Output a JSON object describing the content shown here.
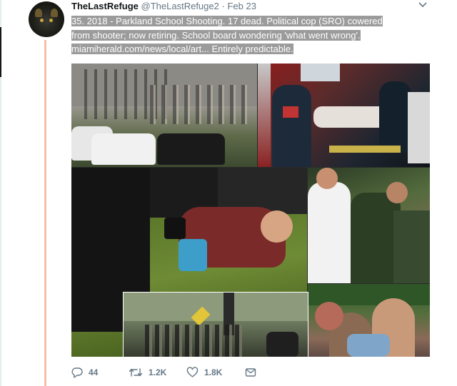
{
  "tweet": {
    "display_name": "TheLastRefuge",
    "handle": "@TheLastRefuge2",
    "separator": "·",
    "timestamp": "Feb 23",
    "text_line1": "35.  2018 -  Parkland School Shooting.  17 dead.  Political cop (SRO) cowered",
    "text_line2": "from shooter; now retiring.  School board wondering 'what went wrong'.",
    "text_line3": "miamiherald.com/news/local/art...  Entirely predictable."
  },
  "media": {
    "photo_count": 6
  },
  "actions": {
    "reply_count": "44",
    "retweet_count": "1.2K",
    "like_count": "1.8K"
  },
  "colors": {
    "thread_line": "#f5bfa7",
    "selection": "#9b9b9b",
    "muted": "#657786"
  },
  "icons": [
    "avatar-image",
    "caret-down-icon",
    "reply-icon",
    "retweet-icon",
    "like-icon",
    "direct-message-icon"
  ]
}
